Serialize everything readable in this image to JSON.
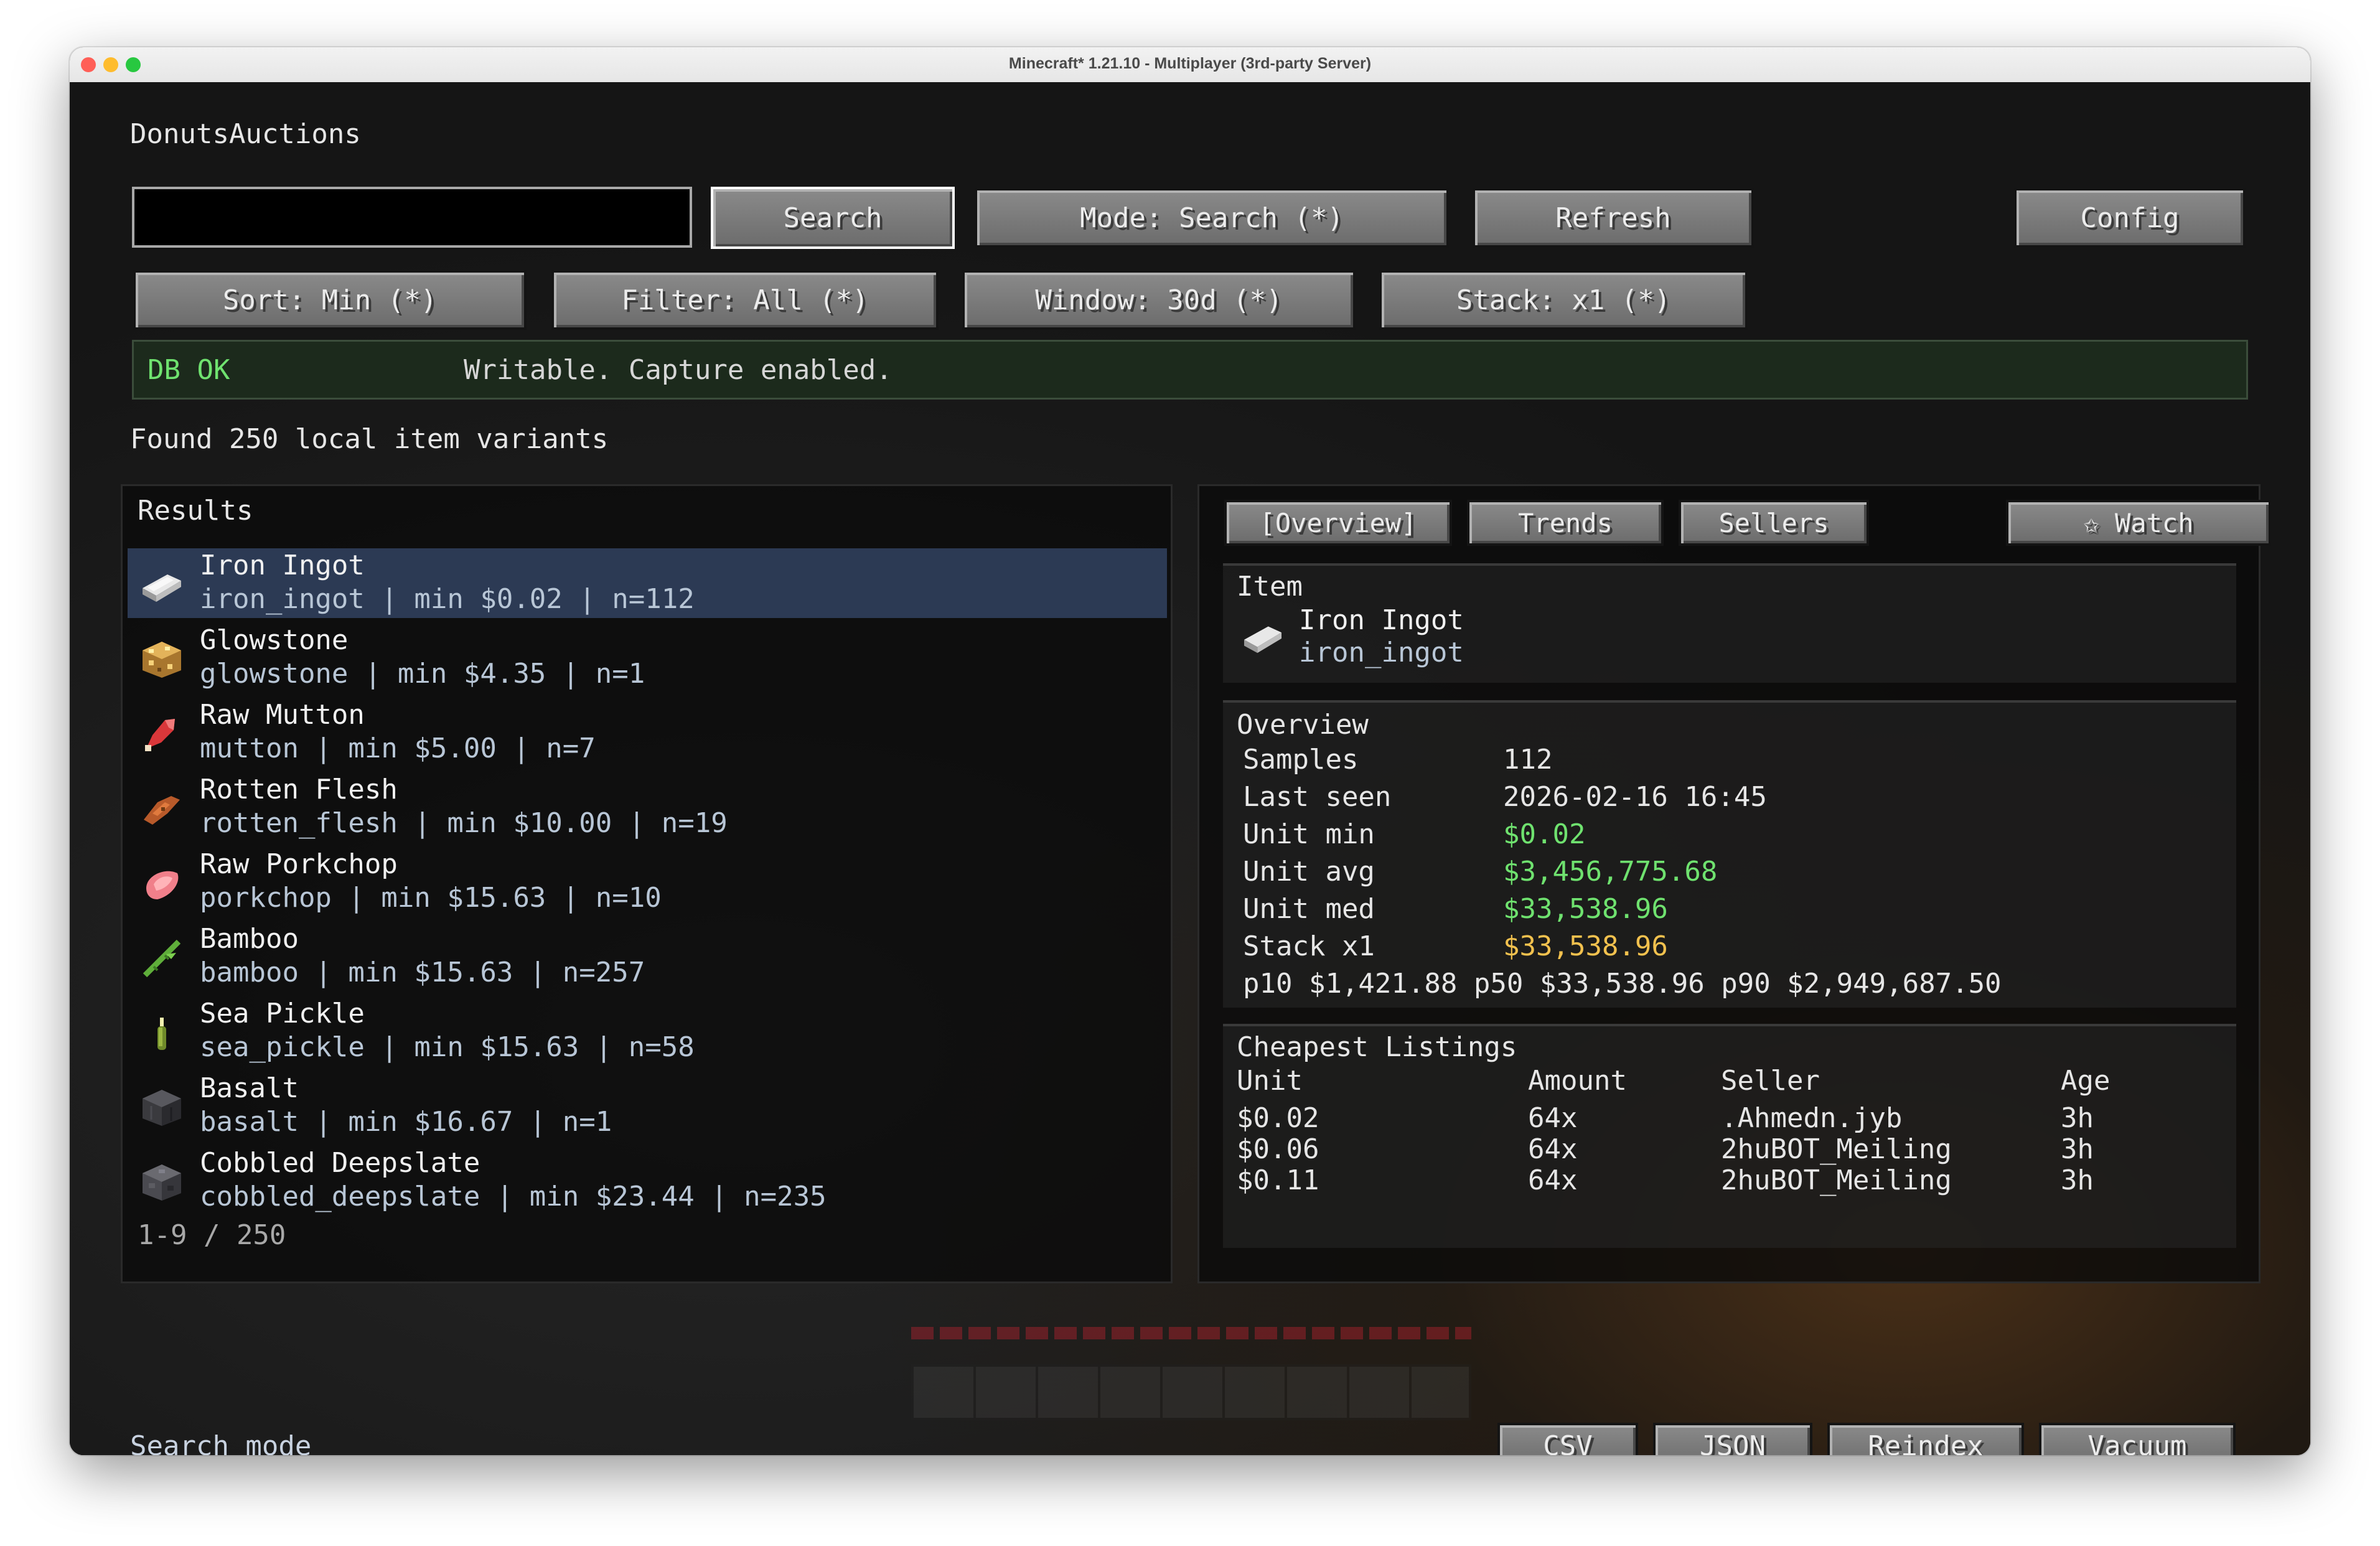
{
  "window": {
    "title": "Minecraft* 1.21.10 - Multiplayer (3rd-party Server)"
  },
  "app": {
    "title": "DonutsAuctions"
  },
  "search": {
    "value": "",
    "placeholder": ""
  },
  "toolbar": {
    "search": "Search",
    "mode": "Mode: Search (*)",
    "refresh": "Refresh",
    "config": "Config",
    "sort": "Sort: Min (*)",
    "filter": "Filter: All (*)",
    "window": "Window: 30d (*)",
    "stack": "Stack: x1 (*)"
  },
  "status": {
    "badge": "DB OK",
    "message": "Writable. Capture enabled.",
    "color": "#6fe26f"
  },
  "found": "Found 250 local item variants",
  "results": {
    "title": "Results",
    "items": [
      {
        "name": "Iron Ingot",
        "sub": "iron_ingot  |  min $0.02  |  n=112",
        "icon": "iron-ingot-icon"
      },
      {
        "name": "Glowstone",
        "sub": "glowstone  |  min $4.35  |  n=1",
        "icon": "glowstone-icon"
      },
      {
        "name": "Raw Mutton",
        "sub": "mutton  |  min $5.00  |  n=7",
        "icon": "raw-mutton-icon"
      },
      {
        "name": "Rotten Flesh",
        "sub": "rotten_flesh  |  min $10.00  |  n=19",
        "icon": "rotten-flesh-icon"
      },
      {
        "name": "Raw Porkchop",
        "sub": "porkchop  |  min $15.63  |  n=10",
        "icon": "raw-porkchop-icon"
      },
      {
        "name": "Bamboo",
        "sub": "bamboo  |  min $15.63  |  n=257",
        "icon": "bamboo-icon"
      },
      {
        "name": "Sea Pickle",
        "sub": "sea_pickle  |  min $15.63  |  n=58",
        "icon": "sea-pickle-icon"
      },
      {
        "name": "Basalt",
        "sub": "basalt  |  min $16.67  |  n=1",
        "icon": "basalt-icon"
      },
      {
        "name": "Cobbled Deepslate",
        "sub": "cobbled_deepslate  |  min $23.44  |  n=235",
        "icon": "cobbled-deepslate-icon"
      }
    ],
    "pagination": "1-9 / 250"
  },
  "detail": {
    "tabs": {
      "overview": "[Overview]",
      "trends": "Trends",
      "sellers": "Sellers",
      "watch": "✩ Watch"
    },
    "item": {
      "heading": "Item",
      "name": "Iron Ingot",
      "id": "iron_ingot"
    },
    "overview": {
      "heading": "Overview",
      "samples_label": "Samples",
      "samples": "112",
      "last_seen_label": "Last seen",
      "last_seen": "2026-02-16 16:45",
      "unit_min_label": "Unit min",
      "unit_min": "$0.02",
      "unit_avg_label": "Unit avg",
      "unit_avg": "$3,456,775.68",
      "unit_med_label": "Unit med",
      "unit_med": "$33,538.96",
      "stack_label": "Stack x1",
      "stack": "$33,538.96",
      "percentiles": "p10 $1,421.88  p50 $33,538.96  p90 $2,949,687.50"
    },
    "listings": {
      "heading": "Cheapest Listings",
      "headers": [
        "Unit",
        "Amount",
        "Seller",
        "Age"
      ],
      "rows": [
        [
          "$0.02",
          "64x",
          ".Ahmedn.jyb",
          "3h"
        ],
        [
          "$0.06",
          "64x",
          "2huBOT_Meiling",
          "3h"
        ],
        [
          "$0.11",
          "64x",
          "2huBOT_Meiling",
          "3h"
        ]
      ]
    }
  },
  "footer": {
    "mode": "Search mode",
    "csv": "CSV",
    "json": "JSON",
    "reindex": "Reindex",
    "vacuum": "Vacuum"
  },
  "colors": {
    "green": "#6fe26f",
    "gold": "#f2c14e",
    "selected_row": "#2c3a54"
  }
}
